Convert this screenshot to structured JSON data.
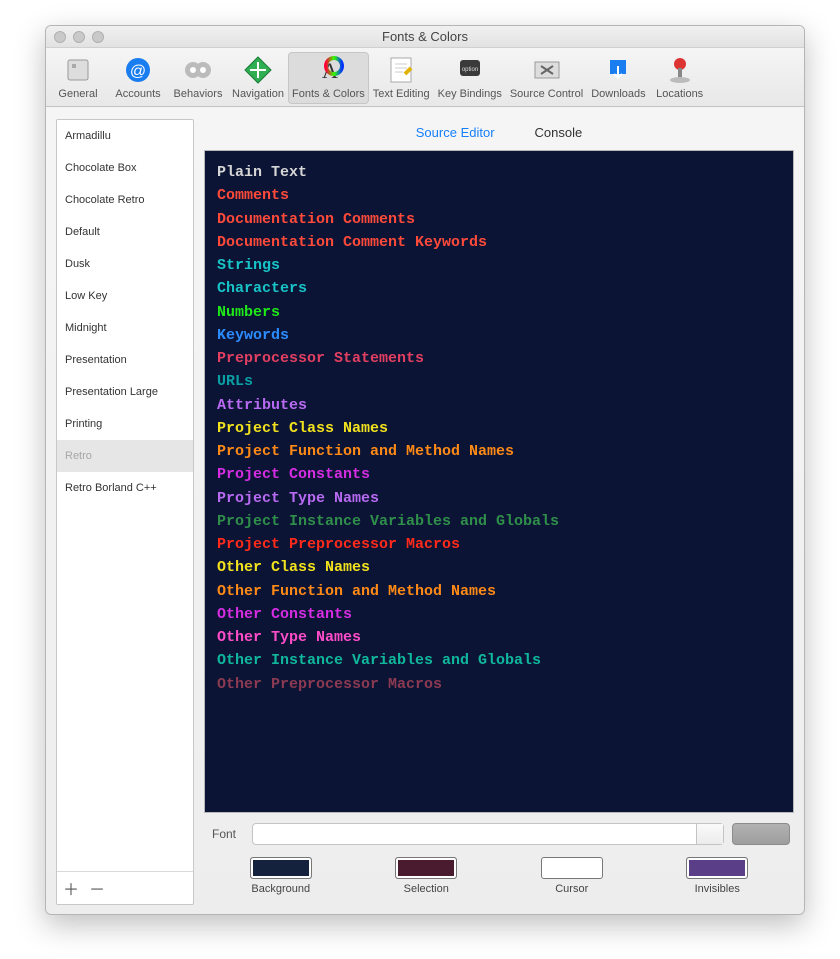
{
  "window": {
    "title": "Fonts & Colors"
  },
  "toolbar": {
    "items": [
      {
        "label": "General"
      },
      {
        "label": "Accounts"
      },
      {
        "label": "Behaviors"
      },
      {
        "label": "Navigation"
      },
      {
        "label": "Fonts & Colors"
      },
      {
        "label": "Text Editing"
      },
      {
        "label": "Key Bindings"
      },
      {
        "label": "Source Control"
      },
      {
        "label": "Downloads"
      },
      {
        "label": "Locations"
      }
    ],
    "selected_index": 4
  },
  "themes": {
    "items": [
      "Armadillu",
      "Chocolate Box",
      "Chocolate Retro",
      "Default",
      "Dusk",
      "Low Key",
      "Midnight",
      "Presentation",
      "Presentation Large",
      "Printing",
      "Retro",
      "Retro Borland C++"
    ],
    "selected_index": 10
  },
  "tabs": {
    "source_editor": "Source Editor",
    "console": "Console",
    "active": "source_editor"
  },
  "syntax": [
    {
      "label": "Plain Text",
      "color": "#d6d6d6"
    },
    {
      "label": "Comments",
      "color": "#ff4a3a"
    },
    {
      "label": "Documentation Comments",
      "color": "#ff4a3a"
    },
    {
      "label": "Documentation Comment Keywords",
      "color": "#ff4a3a"
    },
    {
      "label": "Strings",
      "color": "#17c4c7"
    },
    {
      "label": "Characters",
      "color": "#17c4c7"
    },
    {
      "label": "Numbers",
      "color": "#1fe818"
    },
    {
      "label": "Keywords",
      "color": "#2b8bff"
    },
    {
      "label": "Preprocessor Statements",
      "color": "#e23f61"
    },
    {
      "label": "URLs",
      "color": "#0aa0a3"
    },
    {
      "label": "Attributes",
      "color": "#b86af2"
    },
    {
      "label": "Project Class Names",
      "color": "#f2e21d"
    },
    {
      "label": "Project Function and Method Names",
      "color": "#ff8a16"
    },
    {
      "label": "Project Constants",
      "color": "#d62de3"
    },
    {
      "label": "Project Type Names",
      "color": "#b86af2"
    },
    {
      "label": "Project Instance Variables and Globals",
      "color": "#2f8f4a"
    },
    {
      "label": "Project Preprocessor Macros",
      "color": "#ff2a1a"
    },
    {
      "label": "Other Class Names",
      "color": "#f2e21d"
    },
    {
      "label": "Other Function and Method Names",
      "color": "#ff8a16"
    },
    {
      "label": "Other Constants",
      "color": "#d62de3"
    },
    {
      "label": "Other Type Names",
      "color": "#ff4cc9"
    },
    {
      "label": "Other Instance Variables and Globals",
      "color": "#0fb89c"
    },
    {
      "label": "Other Preprocessor Macros",
      "color": "#8c3a52"
    }
  ],
  "font": {
    "label": "Font",
    "value": ""
  },
  "swatches": {
    "background": {
      "label": "Background",
      "color": "#14223d"
    },
    "selection": {
      "label": "Selection",
      "color": "#4a1a2e"
    },
    "cursor": {
      "label": "Cursor",
      "color": "#ffffff"
    },
    "invisibles": {
      "label": "Invisibles",
      "color": "#5b3e88"
    }
  }
}
